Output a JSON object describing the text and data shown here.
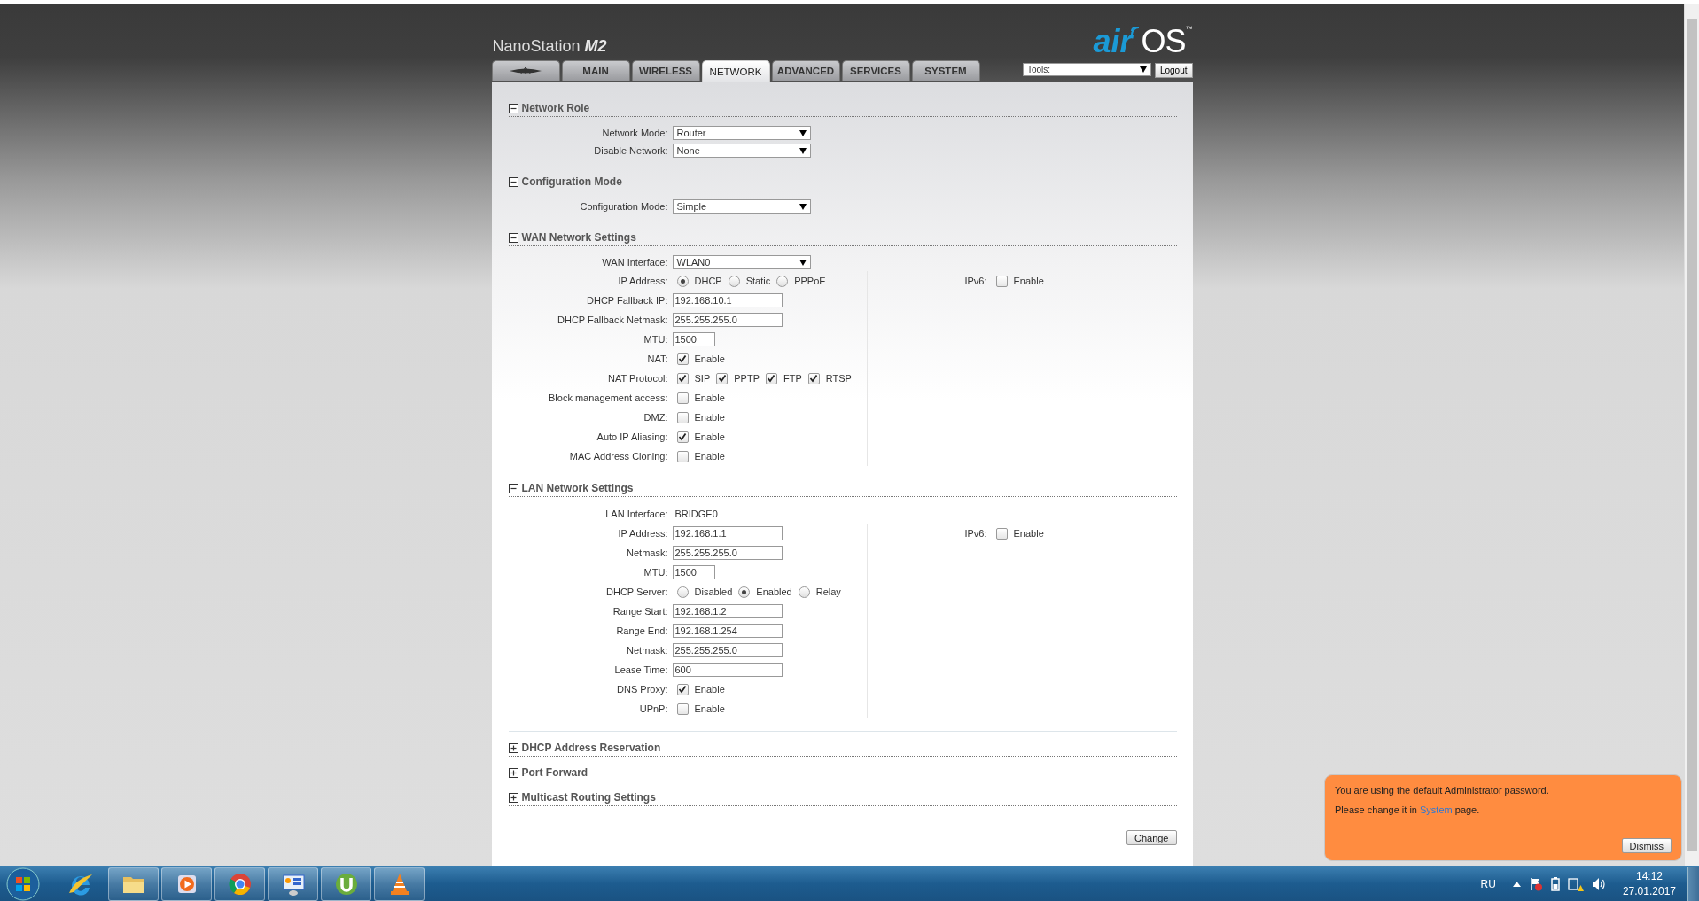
{
  "header": {
    "product_name": "NanoStation",
    "product_model": "M2",
    "logo_text": "air",
    "logo_suffix": "OS",
    "logo_mark": "™"
  },
  "tabs": [
    {
      "kind": "logo",
      "selected": false
    },
    {
      "kind": "text",
      "label": "MAIN",
      "selected": false
    },
    {
      "kind": "text",
      "label": "WIRELESS",
      "selected": false
    },
    {
      "kind": "text",
      "label": "NETWORK",
      "selected": true
    },
    {
      "kind": "text",
      "label": "ADVANCED",
      "selected": false
    },
    {
      "kind": "text",
      "label": "SERVICES",
      "selected": false
    },
    {
      "kind": "text",
      "label": "SYSTEM",
      "selected": false
    }
  ],
  "tools": {
    "value": "Tools:"
  },
  "logout": "Logout",
  "sections": [
    {
      "title": "Network Role",
      "expanded": true,
      "rows": [
        {
          "kind": "select",
          "label": "Network Mode:",
          "value": "Router"
        },
        {
          "kind": "select",
          "label": "Disable Network:",
          "value": "None"
        }
      ]
    },
    {
      "title": "Configuration Mode",
      "expanded": true,
      "rows": [
        {
          "kind": "select",
          "label": "Configuration Mode:",
          "value": "Simple"
        }
      ]
    },
    {
      "title": "WAN Network Settings",
      "expanded": true,
      "rows": [
        {
          "kind": "select",
          "label": "WAN Interface:",
          "value": "WLAN0"
        }
      ],
      "left": [
        {
          "kind": "radio",
          "label": "IP Address:",
          "options": [
            {
              "label": "DHCP",
              "selected": true
            },
            {
              "label": "Static",
              "selected": false
            },
            {
              "label": "PPPoE",
              "selected": false
            }
          ]
        },
        {
          "kind": "input",
          "label": "DHCP Fallback IP:",
          "value": "192.168.10.1"
        },
        {
          "kind": "input",
          "label": "DHCP Fallback Netmask:",
          "value": "255.255.255.0"
        },
        {
          "kind": "input_short",
          "label": "MTU:",
          "value": "1500"
        },
        {
          "kind": "checks",
          "label": "NAT:",
          "options": [
            {
              "label": "Enable",
              "checked": true
            }
          ]
        },
        {
          "kind": "checks",
          "label": "NAT Protocol:",
          "options": [
            {
              "label": "SIP",
              "checked": true
            },
            {
              "label": "PPTP",
              "checked": true
            },
            {
              "label": "FTP",
              "checked": true
            },
            {
              "label": "RTSP",
              "checked": true
            }
          ]
        },
        {
          "kind": "checks",
          "label": "Block management access:",
          "options": [
            {
              "label": "Enable",
              "checked": false
            }
          ]
        },
        {
          "kind": "checks",
          "label": "DMZ:",
          "options": [
            {
              "label": "Enable",
              "checked": false
            }
          ]
        },
        {
          "kind": "checks",
          "label": "Auto IP Aliasing:",
          "options": [
            {
              "label": "Enable",
              "checked": true
            }
          ]
        },
        {
          "kind": "checks",
          "label": "MAC Address Cloning:",
          "options": [
            {
              "label": "Enable",
              "checked": false
            }
          ]
        }
      ],
      "right": [
        {
          "kind": "checks",
          "label": "IPv6:",
          "options": [
            {
              "label": "Enable",
              "checked": false
            }
          ]
        }
      ]
    },
    {
      "title": "LAN Network Settings",
      "expanded": true,
      "rows": [
        {
          "kind": "static",
          "label": "LAN Interface:",
          "value": "BRIDGE0"
        }
      ],
      "left": [
        {
          "kind": "input",
          "label": "IP Address:",
          "value": "192.168.1.1"
        },
        {
          "kind": "input",
          "label": "Netmask:",
          "value": "255.255.255.0"
        },
        {
          "kind": "input_short",
          "label": "MTU:",
          "value": "1500"
        },
        {
          "kind": "radio",
          "label": "DHCP Server:",
          "options": [
            {
              "label": "Disabled",
              "selected": false
            },
            {
              "label": "Enabled",
              "selected": true
            },
            {
              "label": "Relay",
              "selected": false
            }
          ]
        },
        {
          "kind": "input",
          "label": "Range Start:",
          "value": "192.168.1.2"
        },
        {
          "kind": "input",
          "label": "Range End:",
          "value": "192.168.1.254"
        },
        {
          "kind": "input",
          "label": "Netmask:",
          "value": "255.255.255.0"
        },
        {
          "kind": "input",
          "label": "Lease Time:",
          "value": "600"
        },
        {
          "kind": "checks",
          "label": "DNS Proxy:",
          "options": [
            {
              "label": "Enable",
              "checked": true
            }
          ]
        },
        {
          "kind": "checks",
          "label": "UPnP:",
          "options": [
            {
              "label": "Enable",
              "checked": false
            }
          ]
        }
      ],
      "right": [
        {
          "kind": "checks",
          "label": "IPv6:",
          "options": [
            {
              "label": "Enable",
              "checked": false
            }
          ]
        }
      ]
    },
    {
      "title": "DHCP Address Reservation",
      "expanded": false
    },
    {
      "title": "Port Forward",
      "expanded": false
    },
    {
      "title": "Multicast Routing Settings",
      "expanded": false
    }
  ],
  "submit": "Change",
  "notification": {
    "message": "You are using the default Administrator password.",
    "prompt_before": "Please change it in ",
    "link": "System",
    "prompt_after": " page.",
    "button": "Dismiss"
  },
  "taskbar": {
    "apps": [
      {
        "kind": "ie",
        "running": false
      },
      {
        "kind": "folder",
        "running": true
      },
      {
        "kind": "player",
        "running": true
      },
      {
        "kind": "chrome",
        "running": true
      },
      {
        "kind": "panel",
        "running": true
      },
      {
        "kind": "torrent",
        "running": true
      },
      {
        "kind": "cone",
        "running": true
      }
    ],
    "language": "RU",
    "time": "14:12",
    "date": "27.01.2017"
  }
}
